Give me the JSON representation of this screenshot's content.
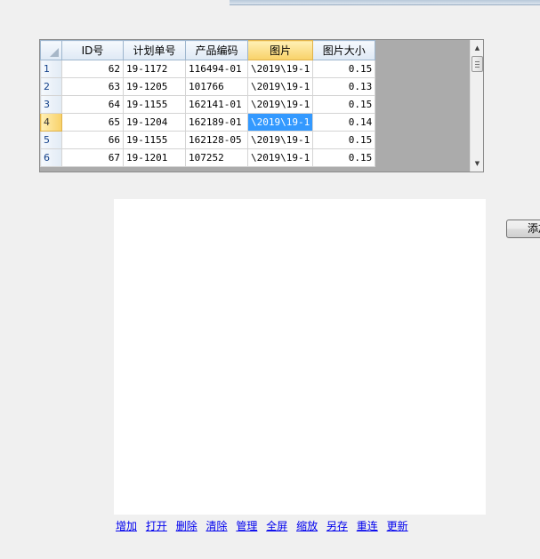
{
  "grid": {
    "columns": [
      "ID号",
      "计划单号",
      "产品编码",
      "图片",
      "图片大小"
    ],
    "active_column": 3,
    "rows": [
      {
        "row_no": "1",
        "id": "62",
        "plan_no": "19-1172",
        "product_code": "116494-01",
        "picture": "\\2019\\19-1",
        "size": "0.15"
      },
      {
        "row_no": "2",
        "id": "63",
        "plan_no": "19-1205",
        "product_code": "101766",
        "picture": "\\2019\\19-1",
        "size": "0.13"
      },
      {
        "row_no": "3",
        "id": "64",
        "plan_no": "19-1155",
        "product_code": "162141-01",
        "picture": "\\2019\\19-1",
        "size": "0.15"
      },
      {
        "row_no": "4",
        "id": "65",
        "plan_no": "19-1204",
        "product_code": "162189-01",
        "picture": "\\2019\\19-1",
        "size": "0.14"
      },
      {
        "row_no": "5",
        "id": "66",
        "plan_no": "19-1155",
        "product_code": "162128-05",
        "picture": "\\2019\\19-1",
        "size": "0.15"
      },
      {
        "row_no": "6",
        "id": "67",
        "plan_no": "19-1201",
        "product_code": "107252",
        "picture": "\\2019\\19-1",
        "size": "0.15"
      }
    ],
    "selected_row": 3,
    "scrollbar": {
      "up_arrow": "▲",
      "down_arrow": "▼"
    }
  },
  "side_button": {
    "label": "添加"
  },
  "links": [
    "增加",
    "打开",
    "删除",
    "清除",
    "管理",
    "全屏",
    "缩放",
    "另存",
    "重连",
    "更新"
  ],
  "colors": {
    "selection": "#3399ff",
    "active_header": "#f8d168",
    "link": "#0000ee",
    "grid_empty": "#ababab"
  }
}
